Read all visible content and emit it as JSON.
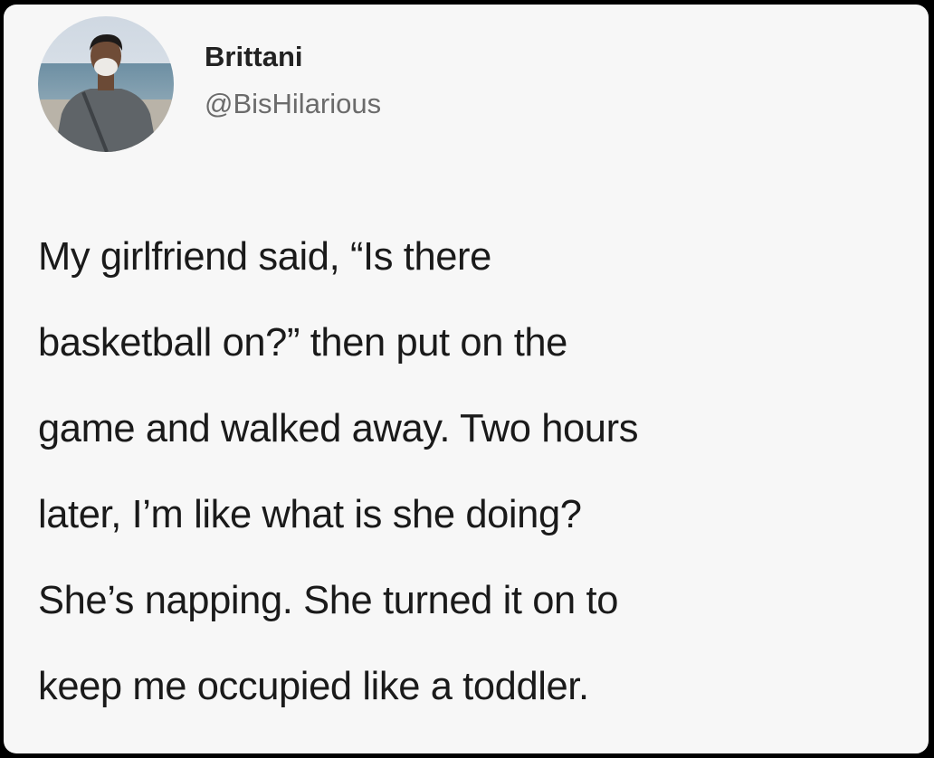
{
  "tweet": {
    "author": {
      "display_name": "Brittani",
      "handle": "@BisHilarious"
    },
    "text_lines": [
      "My girlfriend said, “Is there",
      "basketball on?” then put on the",
      "game and walked away. Two hours",
      "later, I’m like what is she doing?",
      "She’s napping. She turned it on to",
      "keep me occupied like a toddler."
    ]
  },
  "colors": {
    "background": "#000000",
    "card": "#f7f7f7",
    "name": "#222222",
    "handle": "#6b6b6b",
    "text": "#1a1a1a"
  }
}
